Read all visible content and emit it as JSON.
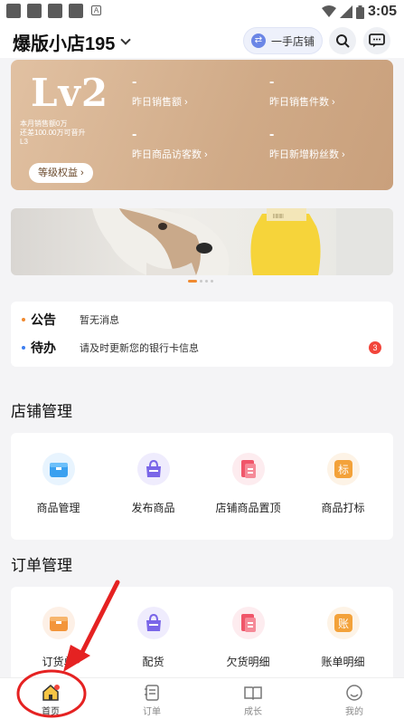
{
  "status_bar": {
    "time": "3:05",
    "a_icon": "A"
  },
  "header": {
    "shop_name": "爆版小店195",
    "switch_label": "一手店铺",
    "switch_icon": "swap-icon",
    "search_icon": "search-icon",
    "message_icon": "message-icon"
  },
  "level_card": {
    "level": "Lv2",
    "sub_lines": [
      "本月销售额0万",
      "还差100.00万可晋升",
      "L3"
    ],
    "button": "等级权益 ›",
    "stats": [
      {
        "value": "-",
        "label": "昨日销售额 ›"
      },
      {
        "value": "-",
        "label": "昨日销售件数 ›"
      },
      {
        "value": "-",
        "label": "昨日商品访客数 ›"
      },
      {
        "value": "-",
        "label": "昨日新增粉丝数 ›"
      }
    ]
  },
  "carousel": {
    "slides": 4,
    "active": 0
  },
  "notices": [
    {
      "tag": "公告",
      "text": "暂无消息",
      "bullet_color": "#f08a30"
    },
    {
      "tag": "待办",
      "text": "请及时更新您的银行卡信息",
      "bullet_color": "#3d7ef0",
      "badge": "3"
    }
  ],
  "shop_management": {
    "title": "店铺管理",
    "items": [
      {
        "label": "商品管理",
        "icon": "box-icon",
        "color": "#3aa0f0",
        "bg": "#e8f4fe"
      },
      {
        "label": "发布商品",
        "icon": "bag-icon",
        "color": "#7a66e8",
        "bg": "#efecfd"
      },
      {
        "label": "店铺商品置顶",
        "icon": "doc-icon",
        "color": "#f0566a",
        "bg": "#fdecef"
      },
      {
        "label": "商品打标",
        "icon": "tag-icon",
        "color": "#f3a23a",
        "bg": "#fdf3e6",
        "glyph": "标"
      }
    ]
  },
  "order_management": {
    "title": "订单管理",
    "items": [
      {
        "label": "订货单",
        "icon": "box-icon",
        "color": "#f3953a",
        "bg": "#fdf0e6"
      },
      {
        "label": "配货",
        "icon": "bag-icon",
        "color": "#7a66e8",
        "bg": "#efecfd"
      },
      {
        "label": "欠货明细",
        "icon": "doc-icon",
        "color": "#f0566a",
        "bg": "#fdecef"
      },
      {
        "label": "账单明细",
        "icon": "bill-icon",
        "color": "#f3a23a",
        "bg": "#fdf3e6",
        "glyph": "账"
      }
    ]
  },
  "tabbar": {
    "tabs": [
      {
        "label": "首页",
        "icon": "home-icon",
        "active": true
      },
      {
        "label": "订单",
        "icon": "order-icon",
        "active": false
      },
      {
        "label": "成长",
        "icon": "book-icon",
        "active": false
      },
      {
        "label": "我的",
        "icon": "profile-icon",
        "active": false
      }
    ]
  },
  "accent": "#f08a30"
}
